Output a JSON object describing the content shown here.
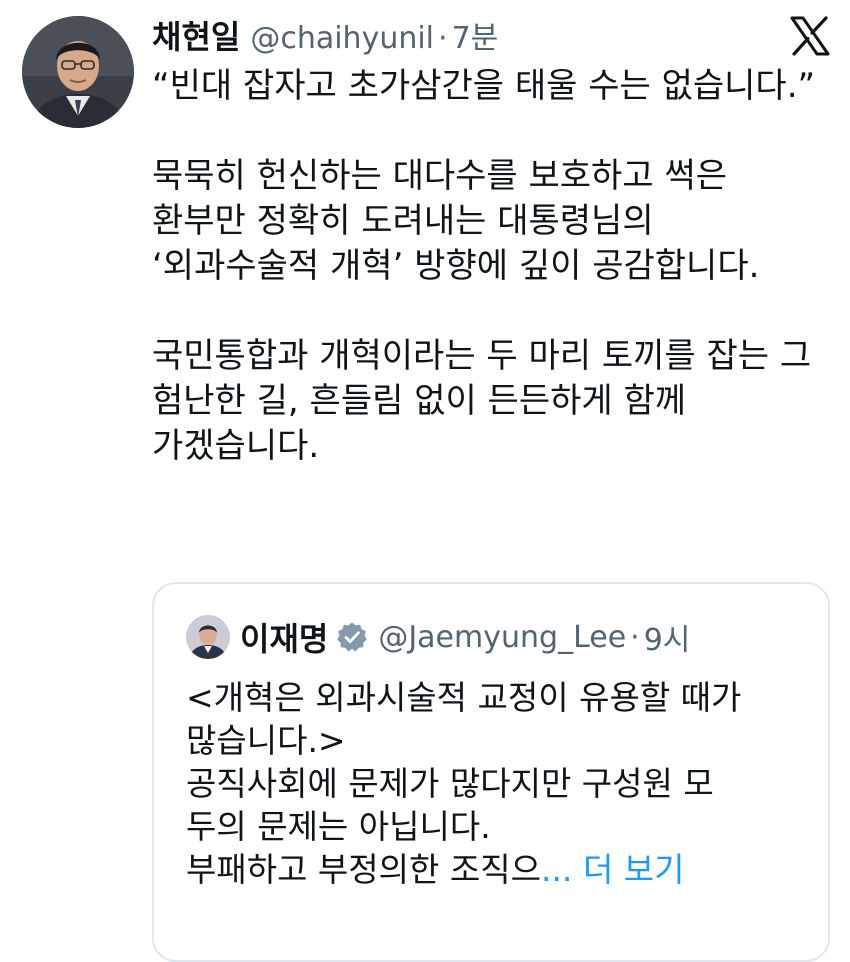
{
  "tweet": {
    "author": {
      "name": "채현일",
      "handle": "@chaihyunil",
      "separator": "·",
      "time": "7분"
    },
    "logo_icon": "x-logo-icon",
    "paragraphs": [
      "“빈대 잡자고 초가삼간을 태울 수는 없습니다.”",
      "묵묵히 헌신하는 대다수를 보호하고 썩은 환부만 정확히 도려내는 대통령님의 ‘외과수술적 개혁’ 방향에 깊이 공감합니다.",
      "국민통합과 개혁이라는 두 마리 토끼를 잡는 그 험난한 길, 흔들림 없이 든든하게 함께 가겠습니다."
    ]
  },
  "quote": {
    "author": {
      "name": "이재명",
      "verified_icon": "verified-badge-icon",
      "handle": "@Jaemyung_Lee",
      "separator": "·",
      "time": "9시"
    },
    "lines": [
      "<개혁은 외과시술적 교정이 유용할 때가",
      "많습니다.>",
      "공직사회에 문제가 많다지만 구성원 모",
      "두의 문제는 아닙니다.",
      "부패하고 부정의한 조직으"
    ],
    "ellipsis": "...",
    "more_label": "더 보기"
  },
  "colors": {
    "text": "#0f1419",
    "secondary": "#536471",
    "link": "#1d9bf0",
    "verified": "#829aab",
    "border": "#e1e8ed"
  }
}
